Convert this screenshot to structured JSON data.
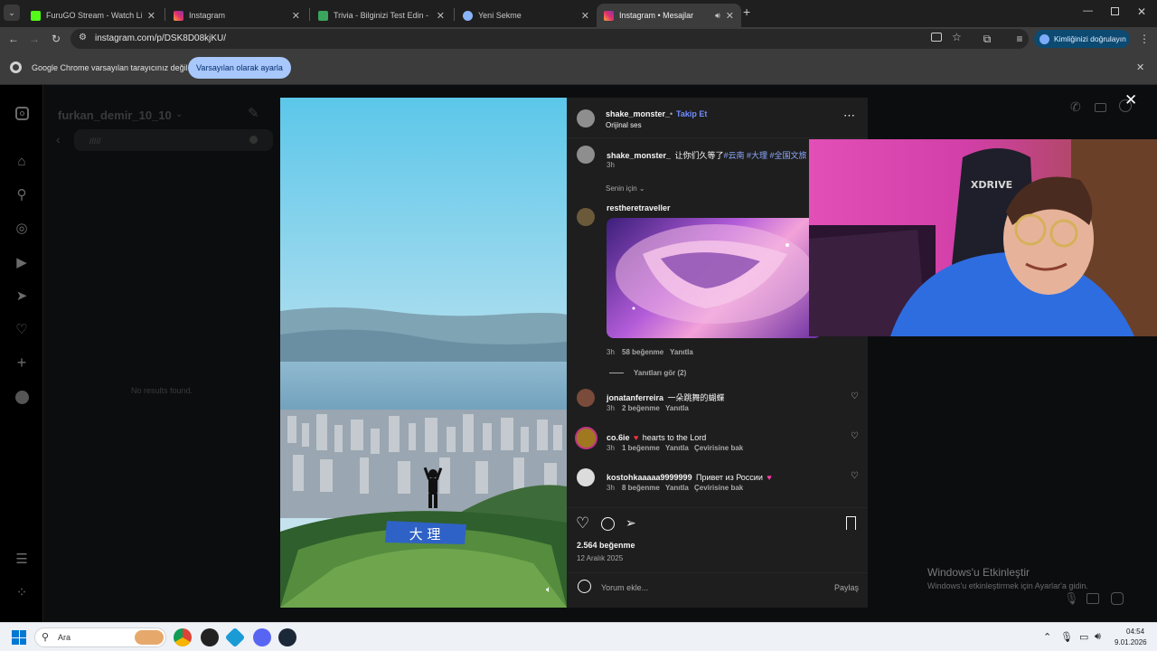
{
  "browser": {
    "tabs": [
      {
        "title": "FuruGO Stream - Watch Live on",
        "favicon_color": "#53fc18"
      },
      {
        "title": "Instagram",
        "favicon_color": "#e1306c"
      },
      {
        "title": "Trivia - Bilginizi Test Edin - Quiz",
        "favicon_color": "#3aa55d"
      },
      {
        "title": "Yeni Sekme",
        "favicon_color": "#8ab4f8"
      },
      {
        "title": "Instagram • Mesajlar",
        "favicon_color": "#e1306c"
      }
    ],
    "new_tab": "+",
    "url": "instagram.com/p/DSK8D08kjKU/",
    "profile_label": "Kimliğinizi doğrulayın",
    "infobar_text": "Google Chrome varsayılan tarayıcınız değil",
    "infobar_button": "Varsayılan olarak ayarla"
  },
  "dm_panel": {
    "username": "furkan_demir_10_10",
    "search_value": "/////",
    "no_results": "No results found."
  },
  "post": {
    "author": "shake_monster_",
    "follow": "Takip Et",
    "audio": "Orijinal ses",
    "caption_text": "让你们久等了",
    "caption_tags": "#云南 #大理 #全国文旅",
    "caption_time": "3h",
    "filter_label": "Senin için",
    "sign_text": "大 理",
    "likes": "2.564 beğenme",
    "date": "12 Aralık 2025",
    "comment_placeholder": "Yorum ekle...",
    "share": "Paylaş"
  },
  "comments": [
    {
      "user": "restheretraveller",
      "text": "",
      "time": "3h",
      "likes": "58 beğenme",
      "reply": "Yanıtla",
      "view_replies": "Yanıtları gör (2)",
      "avatar_color": "#6b5a3a"
    },
    {
      "user": "jonatanferreira",
      "text": "一朵跳舞的蝴蝶",
      "time": "3h",
      "likes": "2 beğenme",
      "reply": "Yanıtla",
      "avatar_color": "#7a4a3a"
    },
    {
      "user": "co.6ie",
      "text": "hearts to the Lord",
      "emoji": "♥",
      "time": "3h",
      "likes": "1 beğenme",
      "reply": "Yanıtla",
      "translate": "Çevirisine bak",
      "avatar_color": "#a07820"
    },
    {
      "user": "kostohkaaaaa9999999",
      "text": "Привет из России",
      "emoji": "♥",
      "time": "3h",
      "likes": "8 beğenme",
      "reply": "Yanıtla",
      "translate": "Çevirisine bak",
      "avatar_color": "#dcdcdc"
    }
  ],
  "watermark": {
    "title": "Windows'u Etkinleştir",
    "subtitle": "Windows'u etkinleştirmek için Ayarlar'a gidin."
  },
  "taskbar": {
    "search_placeholder": "Ara",
    "time": "04:54",
    "date": "9.01.2026"
  },
  "colors": {
    "accent_blue": "#0095f6",
    "follow_blue": "#708dff",
    "heart_red": "#ff3040"
  }
}
